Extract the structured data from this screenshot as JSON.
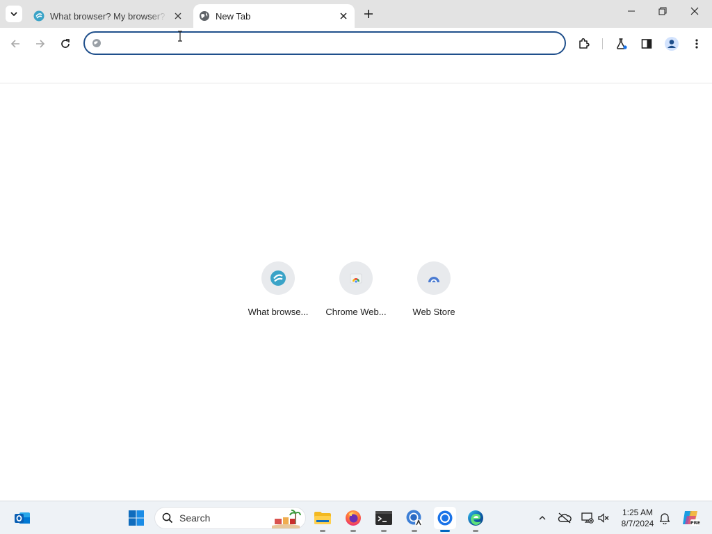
{
  "browser": {
    "tabs": [
      {
        "title": "What browser? My browser? Is",
        "icon": "whatbrowser-favicon",
        "active": false
      },
      {
        "title": "New Tab",
        "icon": "globe-icon",
        "active": true
      }
    ],
    "omnibox": {
      "value": "",
      "placeholder": "",
      "icon": "search-engine-icon"
    },
    "colors": {
      "accent": "#1f4f8b",
      "tabstrip": "#e3e3e3"
    }
  },
  "ntp": {
    "shortcuts": [
      {
        "label": "What browse...",
        "icon": "whatbrowser-icon"
      },
      {
        "label": "Chrome Web...",
        "icon": "chrome-web-store-icon"
      },
      {
        "label": "Web Store",
        "icon": "web-store-icon"
      }
    ]
  },
  "taskbar": {
    "search_label": "Search",
    "apps": [
      "outlook-icon",
      "windows-start-icon",
      "file-explorer-icon",
      "firefox-icon",
      "terminal-icon",
      "chrome-canary-icon",
      "chrome-icon",
      "edge-icon"
    ],
    "clock": {
      "time": "1:25 AM",
      "date": "8/7/2024"
    }
  }
}
